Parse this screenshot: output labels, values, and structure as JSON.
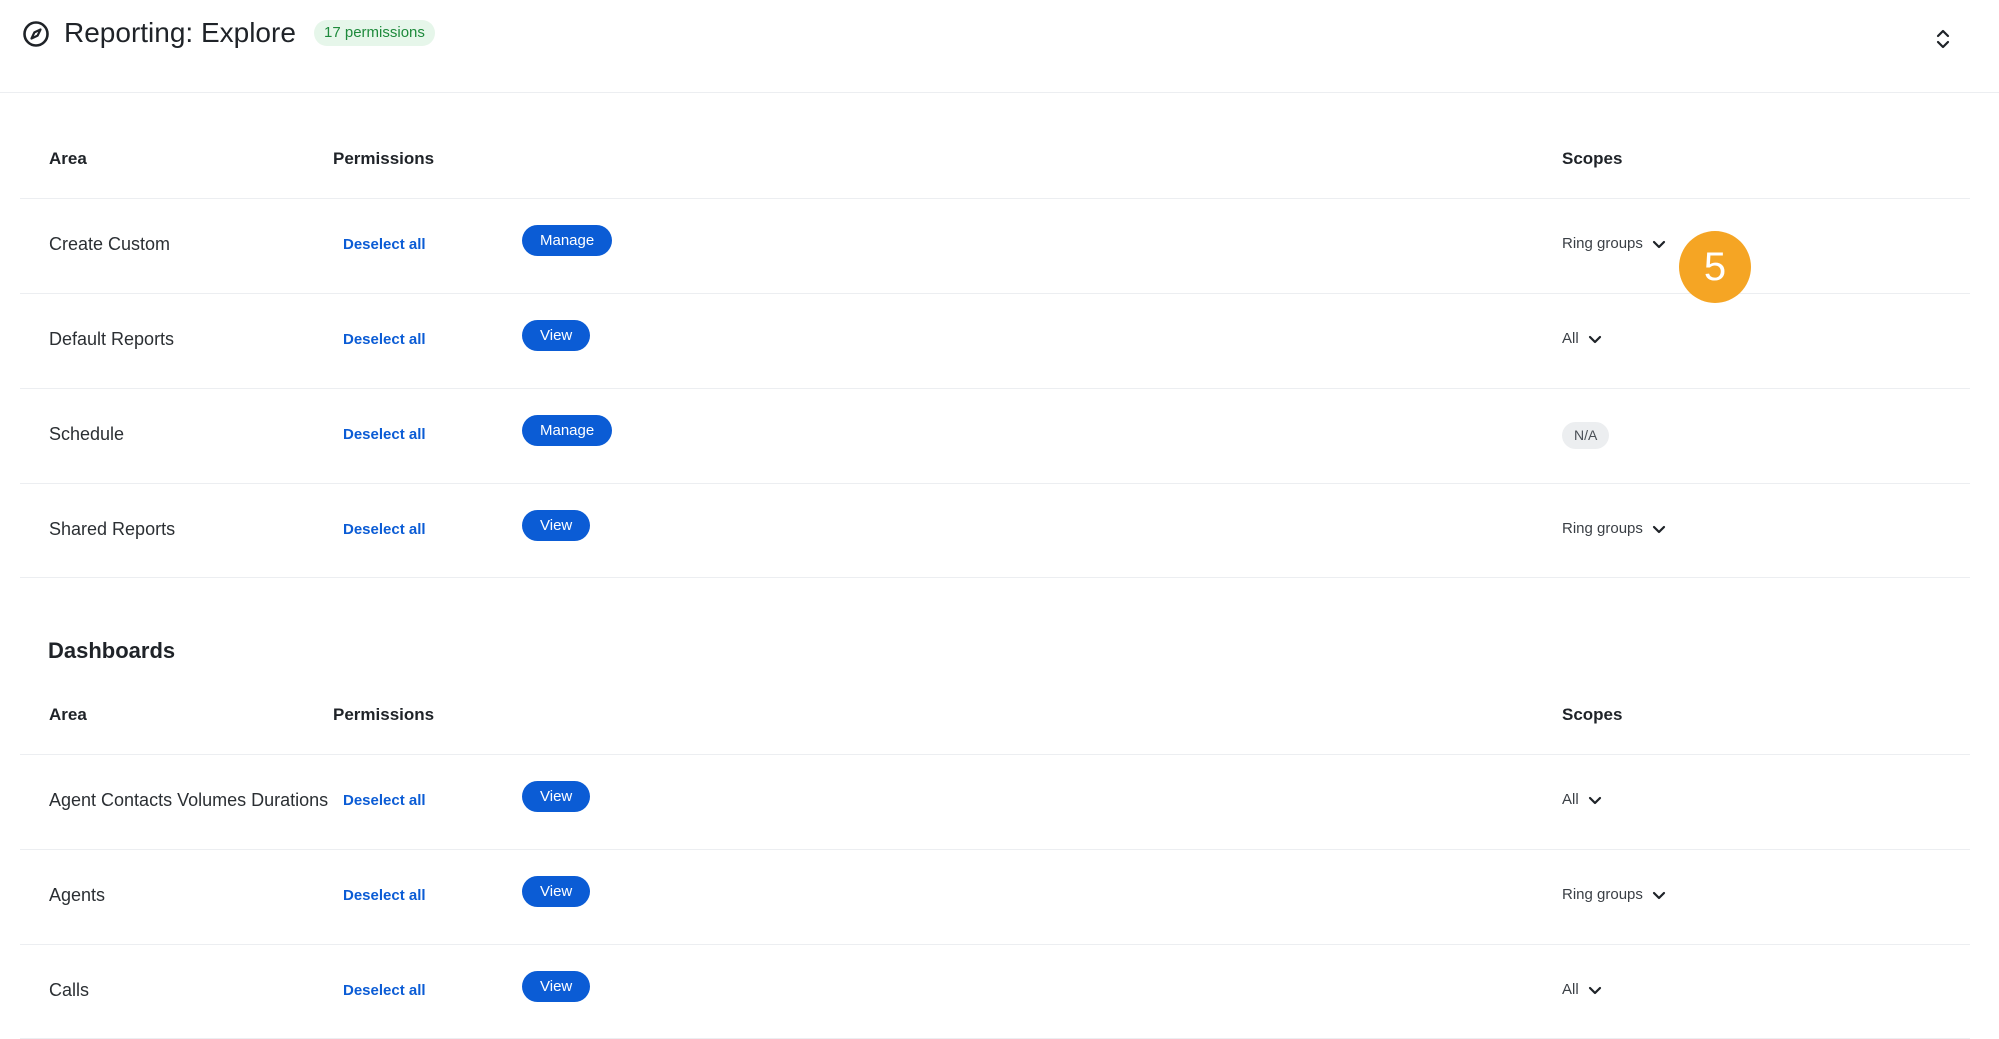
{
  "header": {
    "title": "Reporting: Explore",
    "badge": "17 permissions",
    "icon": "compass-icon",
    "collapse_icon": "collapse-icon"
  },
  "columns": {
    "area": "Area",
    "permissions": "Permissions",
    "scopes": "Scopes"
  },
  "explore_rows": [
    {
      "area": "Create Custom",
      "deselect": "Deselect all",
      "permission": "Manage",
      "scope": "Ring groups"
    },
    {
      "area": "Default Reports",
      "deselect": "Deselect all",
      "permission": "View",
      "scope": "All"
    },
    {
      "area": "Schedule",
      "deselect": "Deselect all",
      "permission": "Manage",
      "scope_badge": "N/A"
    },
    {
      "area": "Shared Reports",
      "deselect": "Deselect all",
      "permission": "View",
      "scope": "Ring groups"
    }
  ],
  "dashboards": {
    "title": "Dashboards",
    "rows": [
      {
        "area": "Agent Contacts Volumes Durations",
        "deselect": "Deselect all",
        "permission": "View",
        "scope": "All"
      },
      {
        "area": "Agents",
        "deselect": "Deselect all",
        "permission": "View",
        "scope": "Ring groups"
      },
      {
        "area": "Calls",
        "deselect": "Deselect all",
        "permission": "View",
        "scope": "All"
      }
    ]
  },
  "step_marker": "5",
  "colors": {
    "accent": "#0b5cd5",
    "badge_bg": "#e6f6ea",
    "badge_text": "#1e8a3c",
    "marker": "#f5a524"
  }
}
